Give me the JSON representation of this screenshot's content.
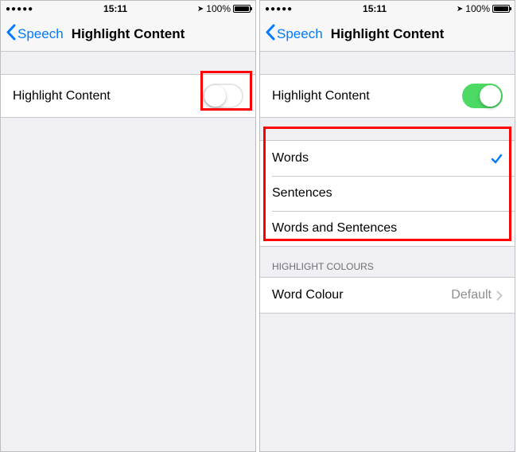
{
  "status": {
    "signal": "●●●●●",
    "time": "15:11",
    "location_icon": "➤",
    "battery_pct": "100%"
  },
  "nav": {
    "back_label": "Speech",
    "title": "Highlight Content"
  },
  "left": {
    "toggle_label": "Highlight Content",
    "toggle_on": false
  },
  "right": {
    "toggle_label": "Highlight Content",
    "toggle_on": true,
    "options": {
      "0": {
        "label": "Words",
        "selected": true
      },
      "1": {
        "label": "Sentences",
        "selected": false
      },
      "2": {
        "label": "Words and Sentences",
        "selected": false
      }
    },
    "colours_header": "HIGHLIGHT COLOURS",
    "word_colour_label": "Word Colour",
    "word_colour_value": "Default"
  }
}
